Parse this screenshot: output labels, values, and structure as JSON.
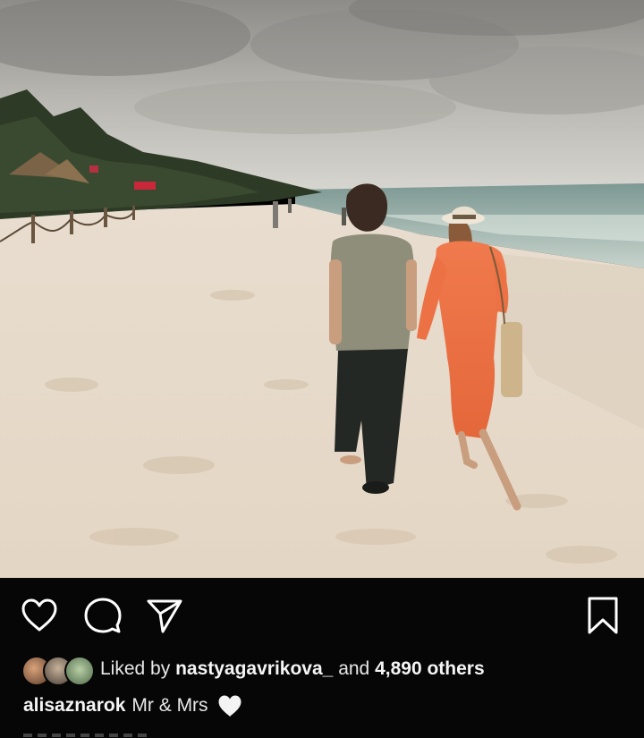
{
  "post": {
    "image_description_icon": "beach-photo",
    "liked_by_prefix": "Liked by",
    "liked_by_user": "nastyagavrikova_",
    "liked_by_and": "and",
    "liked_by_count": "4,890 others",
    "caption_user": "alisaznarok",
    "caption_text": "Mr & Mrs",
    "caption_emoji": "white-heart-icon"
  },
  "actions": {
    "like_icon": "heart-outline-icon",
    "comment_icon": "comment-bubble-icon",
    "share_icon": "paper-plane-icon",
    "save_icon": "bookmark-icon"
  },
  "colors": {
    "background": "#060606",
    "text": "#f2f2f2",
    "icon": "#ffffff"
  }
}
